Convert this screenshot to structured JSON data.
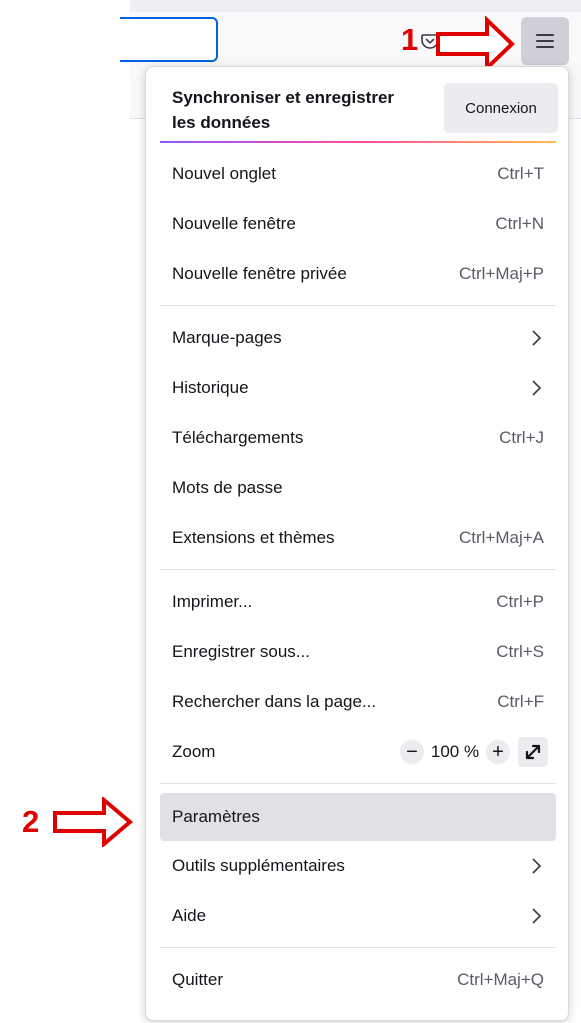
{
  "annotations": {
    "step1": "1",
    "step2": "2",
    "arrow_color": "#e00000"
  },
  "toolbar": {
    "menu_icon": "hamburger-menu-icon",
    "pocket_icon": "pocket-icon"
  },
  "sync": {
    "text": "Synchroniser et enregistrer les données",
    "button": "Connexion"
  },
  "menu": {
    "new_tab": {
      "label": "Nouvel onglet",
      "shortcut": "Ctrl+T"
    },
    "new_window": {
      "label": "Nouvelle fenêtre",
      "shortcut": "Ctrl+N"
    },
    "private_window": {
      "label": "Nouvelle fenêtre privée",
      "shortcut": "Ctrl+Maj+P"
    },
    "bookmarks": {
      "label": "Marque-pages"
    },
    "history": {
      "label": "Historique"
    },
    "downloads": {
      "label": "Téléchargements",
      "shortcut": "Ctrl+J"
    },
    "passwords": {
      "label": "Mots de passe"
    },
    "addons": {
      "label": "Extensions et thèmes",
      "shortcut": "Ctrl+Maj+A"
    },
    "print": {
      "label": "Imprimer...",
      "shortcut": "Ctrl+P"
    },
    "save_as": {
      "label": "Enregistrer sous...",
      "shortcut": "Ctrl+S"
    },
    "find": {
      "label": "Rechercher dans la page...",
      "shortcut": "Ctrl+F"
    },
    "zoom": {
      "label": "Zoom",
      "minus": "−",
      "value": "100 %",
      "plus": "+"
    },
    "settings": {
      "label": "Paramètres"
    },
    "more_tools": {
      "label": "Outils supplémentaires"
    },
    "help": {
      "label": "Aide"
    },
    "quit": {
      "label": "Quitter",
      "shortcut": "Ctrl+Maj+Q"
    }
  },
  "colors": {
    "accent": "#0061e0",
    "hover_bg": "#e0e0e6",
    "menu_button_bg": "#cfcfd8"
  }
}
